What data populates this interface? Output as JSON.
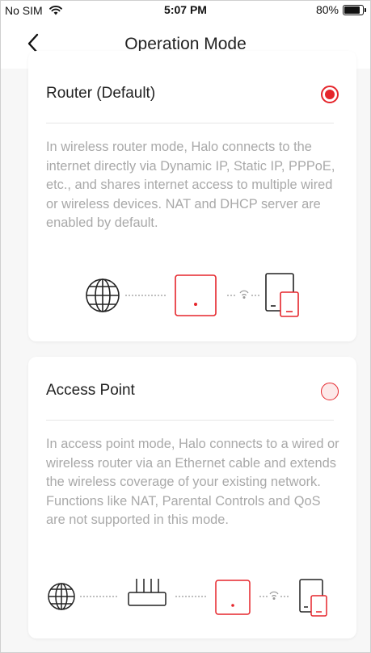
{
  "status_bar": {
    "carrier": "No SIM",
    "time": "5:07 PM",
    "battery": "80%",
    "battery_level": 0.8
  },
  "nav": {
    "title": "Operation Mode",
    "back_icon": "chevron-left-icon"
  },
  "modes": [
    {
      "title": "Router (Default)",
      "selected": true,
      "description": "In wireless router mode, Halo connects to the internet directly via Dynamic IP, Static IP, PPPoE, etc., and shares internet access to multiple wired or wireless devices. NAT and DHCP server are enabled by default.",
      "diagram_icons": [
        "globe-icon",
        "halo-device-icon",
        "wifi-icon",
        "client-devices-icon"
      ]
    },
    {
      "title": "Access Point",
      "selected": false,
      "description": "In access point mode, Halo connects to a wired or wireless router via an Ethernet cable and extends the wireless coverage of your existing network. Functions like NAT, Parental Controls and QoS are not supported in this mode.",
      "diagram_icons": [
        "globe-icon",
        "router-icon",
        "halo-device-icon",
        "wifi-icon",
        "client-devices-icon"
      ]
    }
  ],
  "colors": {
    "accent": "#e5252b",
    "text": "#222222",
    "description": "#a9a9a9",
    "background": "#f7f7f7"
  }
}
